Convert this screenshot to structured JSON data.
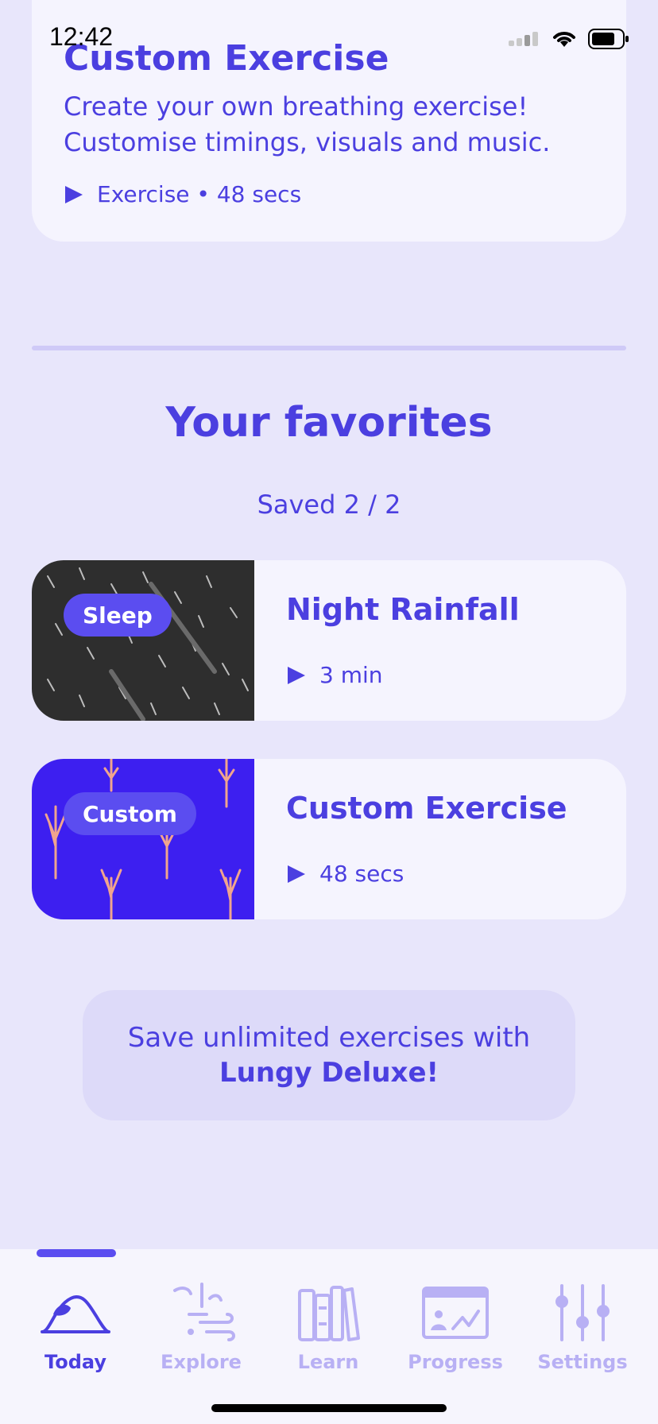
{
  "status": {
    "time": "12:42"
  },
  "top_card": {
    "title": "Custom Exercise",
    "description_line1": "Create your own breathing exercise!",
    "description_line2": "Customise timings, visuals and music.",
    "meta": "Exercise • 48 secs"
  },
  "favorites": {
    "title": "Your favorites",
    "saved": "Saved 2 / 2",
    "items": [
      {
        "tag": "Sleep",
        "name": "Night Rainfall",
        "duration": "3 min"
      },
      {
        "tag": "Custom",
        "name": "Custom Exercise",
        "duration": "48 secs"
      }
    ]
  },
  "promo": {
    "line1": "Save unlimited exercises with",
    "line2": "Lungy Deluxe!"
  },
  "tabs": [
    {
      "label": "Today",
      "icon": "mountain-icon",
      "active": true
    },
    {
      "label": "Explore",
      "icon": "explore-icon",
      "active": false
    },
    {
      "label": "Learn",
      "icon": "books-icon",
      "active": false
    },
    {
      "label": "Progress",
      "icon": "progress-icon",
      "active": false
    },
    {
      "label": "Settings",
      "icon": "sliders-icon",
      "active": false
    }
  ],
  "colors": {
    "accent": "#4b3fe0",
    "background": "#e8e6fb",
    "card": "#f5f4fe",
    "tab_inactive": "#b8b0f4"
  }
}
